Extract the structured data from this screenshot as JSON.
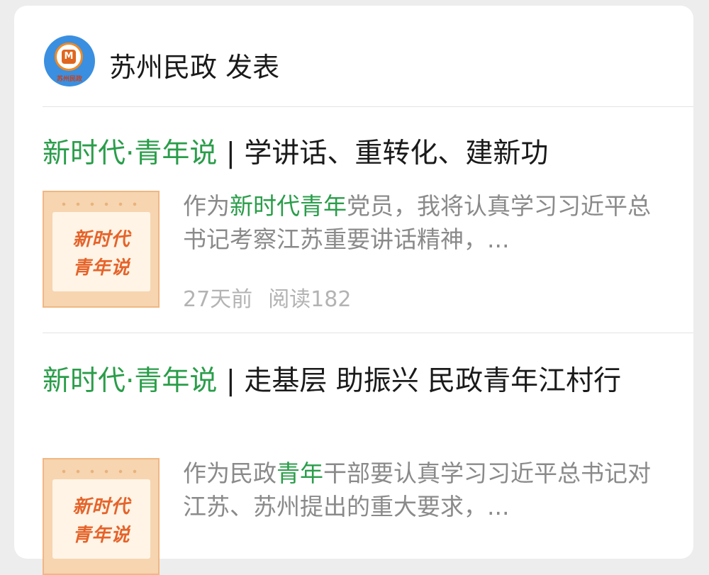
{
  "account": {
    "name": "苏州民政",
    "action": "发表",
    "avatar_label": "苏州民政",
    "avatar_icon": "civil-affairs-emblem-icon"
  },
  "articles": [
    {
      "title_green": "新时代·青年说",
      "title_rest": " | 学讲话、重转化、建新功",
      "thumb_line1": "新时代",
      "thumb_line2": "青年说",
      "summary_parts": [
        "作为",
        "新时代青年",
        "党员，我将认真学习习近平总书记考察江苏重要讲话精神，..."
      ],
      "time": "27天前",
      "reads": "阅读182"
    },
    {
      "title_green": "新时代·青年说",
      "title_rest": " | 走基层 助振兴 民政青年江村行",
      "thumb_line1": "新时代",
      "thumb_line2": "青年说",
      "summary_parts": [
        "作为民政",
        "青年",
        "干部要认真学习习近平总书记对江苏、苏州提出的重大要求，..."
      ]
    }
  ],
  "colors": {
    "highlight_green": "#2a9d4a",
    "thumb_text": "#e5632a",
    "background": "#ededed"
  }
}
